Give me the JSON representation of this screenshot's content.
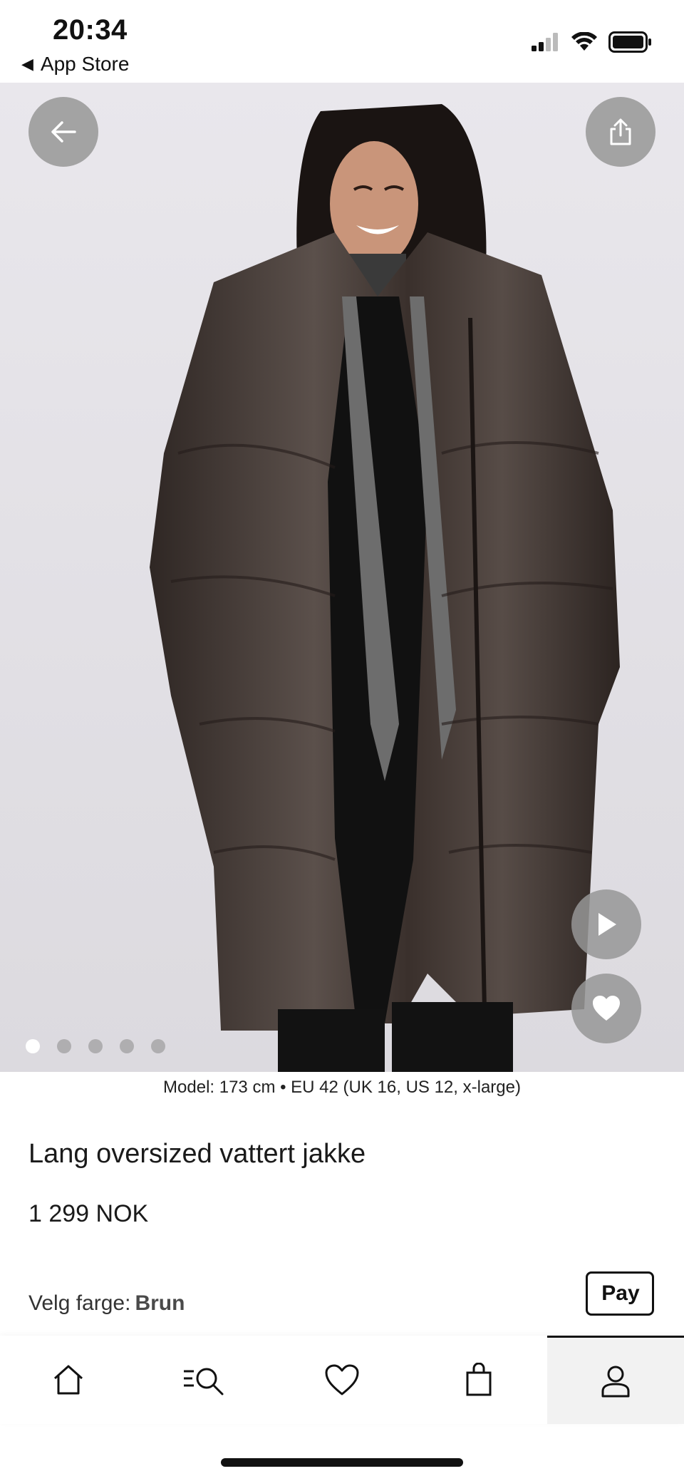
{
  "status_bar": {
    "time": "20:34",
    "back_app": "App Store",
    "icons": [
      "signal-icon",
      "wifi-icon",
      "battery-icon"
    ]
  },
  "hero": {
    "image_description": "",
    "page_count": 5,
    "active_page": 1,
    "buttons": [
      "back-arrow-icon",
      "share-icon",
      "play-icon",
      "heart-icon"
    ]
  },
  "product": {
    "model_info": "Model: 173 cm • EU 42 (UK 16, US 12, x-large)",
    "title": "Lang oversized vattert jakke",
    "price": "1 299 NOK",
    "color_label": "Velg farge:",
    "color_value": "Brun"
  },
  "apple_pay": {
    "label": "Pay"
  },
  "tab_bar": {
    "tabs": [
      {
        "icon": "home-icon",
        "active": false
      },
      {
        "icon": "search-menu-icon",
        "active": false
      },
      {
        "icon": "heart-icon",
        "active": false
      },
      {
        "icon": "shopping-bag-icon",
        "active": false
      },
      {
        "icon": "profile-icon",
        "active": true
      }
    ]
  },
  "colors": {
    "hero_background": "#e6e4e8",
    "coat": "#3f3530",
    "button_overlay": "#969696"
  }
}
